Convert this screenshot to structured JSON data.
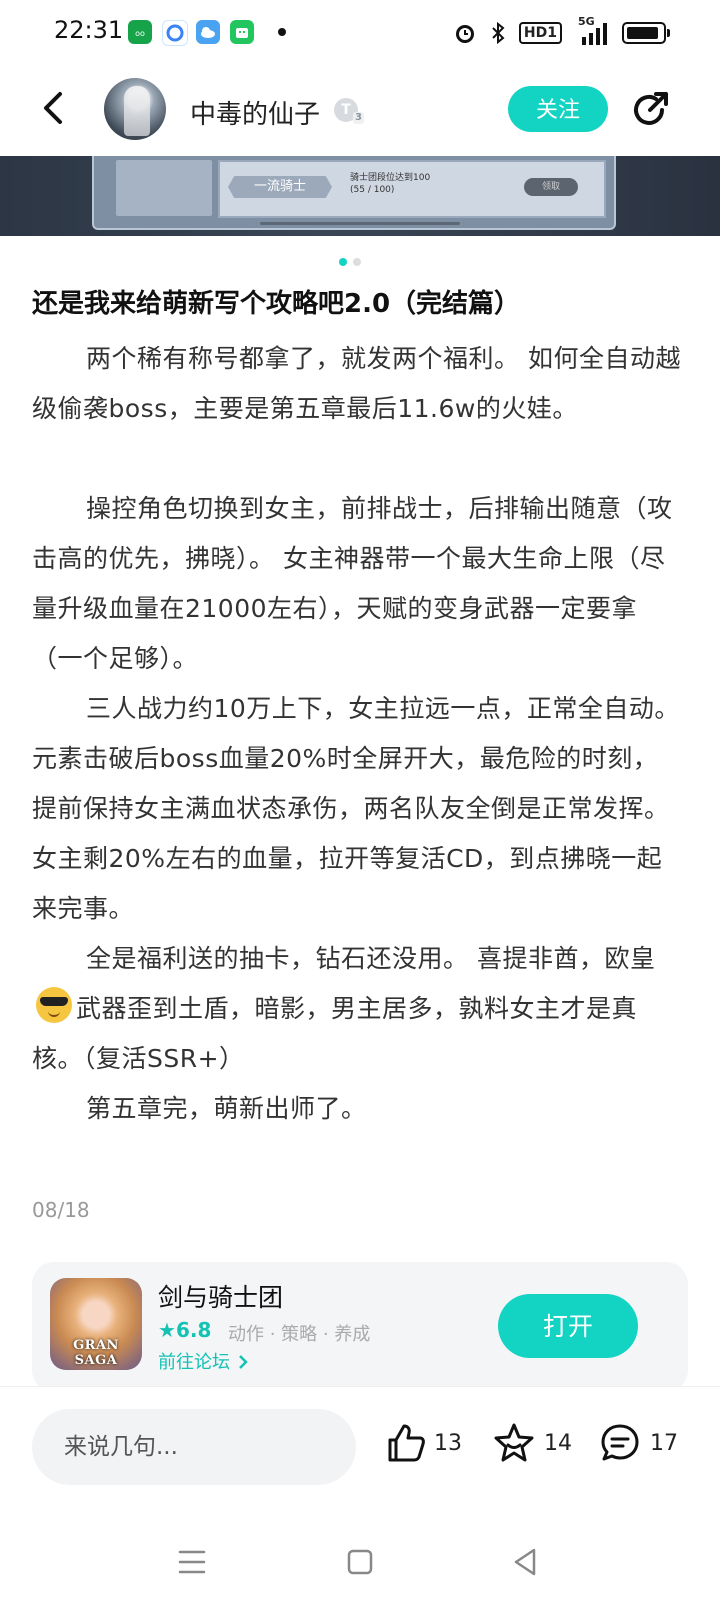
{
  "status_bar": {
    "time": "22:31",
    "network": "5G",
    "hd_label": "HD1",
    "app_icons": [
      "oppo-app-icon",
      "browser-icon",
      "weather-icon",
      "store-icon"
    ],
    "colors": {
      "oppo": "#16a34a",
      "browser": "#3b82f6",
      "weather": "#4aa3f0",
      "store": "#22c55e"
    }
  },
  "header": {
    "username": "中毒的仙子",
    "level": "T",
    "level_sub": "3",
    "follow_label": "关注"
  },
  "banner": {
    "badge_text": "一流骑士",
    "description_line1": "骑士团段位达到100",
    "description_line2": "(55 / 100)",
    "claim_label": "领取"
  },
  "post": {
    "title": "还是我来给萌新写个攻略吧2.0（完结篇）",
    "paragraphs": [
      "两个稀有称号都拿了，就发两个福利。 如何全自动越级偷袭boss，主要是第五章最后11.6w的火娃。",
      "操控角色切换到女主，前排战士，后排输出随意（攻击高的优先，拂晓）。 女主神器带一个最大生命上限（尽量升级血量在21000左右），天赋的变身武器一定要拿（一个足够）。",
      "三人战力约10万上下，女主拉远一点，正常全自动。元素击破后boss血量20%时全屏开大，最危险的时刻，提前保持女主满血状态承伤，两名队友全倒是正常发挥。 女主剩20%左右的血量，拉开等复活CD，到点拂晓一起来完事。",
      "全是福利送的抽卡，钻石还没用。 喜提非酋，欧皇",
      "武器歪到土盾，暗影，男主居多，孰料女主才是真核。（复活SSR+）",
      "第五章完，萌新出师了。"
    ],
    "date": "08/18"
  },
  "game_card": {
    "name": "剑与骑士团",
    "rating": "6.8",
    "tags": "动作 · 策略 · 养成",
    "forum_link": "前往论坛",
    "open_label": "打开",
    "icon_text": "GRAN SAGA",
    "accent": "#13d4c3"
  },
  "bottom_bar": {
    "comment_placeholder": "来说几句...",
    "likes": "13",
    "favorites": "14",
    "comments": "17"
  },
  "carousel": {
    "total": 2,
    "active": 1
  }
}
